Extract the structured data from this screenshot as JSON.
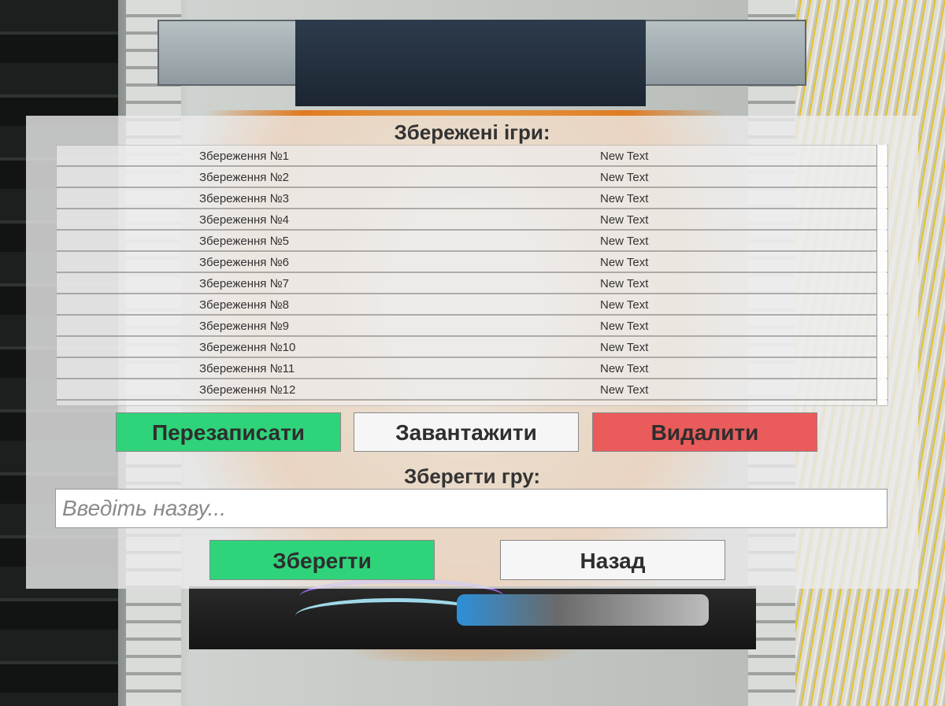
{
  "panel": {
    "title": "Збережені ігри:",
    "saves": [
      {
        "name": "Збереження №1",
        "value": "New Text"
      },
      {
        "name": "Збереження №2",
        "value": "New Text"
      },
      {
        "name": "Збереження №3",
        "value": "New Text"
      },
      {
        "name": "Збереження №4",
        "value": "New Text"
      },
      {
        "name": "Збереження №5",
        "value": "New Text"
      },
      {
        "name": "Збереження №6",
        "value": "New Text"
      },
      {
        "name": "Збереження №7",
        "value": "New Text"
      },
      {
        "name": "Збереження №8",
        "value": "New Text"
      },
      {
        "name": "Збереження №9",
        "value": "New Text"
      },
      {
        "name": "Збереження №10",
        "value": "New Text"
      },
      {
        "name": "Збереження №11",
        "value": "New Text"
      },
      {
        "name": "Збереження №12",
        "value": "New Text"
      }
    ],
    "actions": {
      "overwrite": "Перезаписати",
      "load": "Завантажити",
      "delete": "Видалити"
    },
    "save_section": {
      "title": "Зберегти гру:",
      "input_value": "",
      "input_placeholder": "Введіть назву...",
      "save": "Зберегти",
      "back": "Назад"
    }
  },
  "colors": {
    "green_button": "#2fd47a",
    "red_button": "#ea5b5b",
    "white_button": "#f6f6f6",
    "panel_overlay": "rgba(235,235,235,0.80)"
  }
}
